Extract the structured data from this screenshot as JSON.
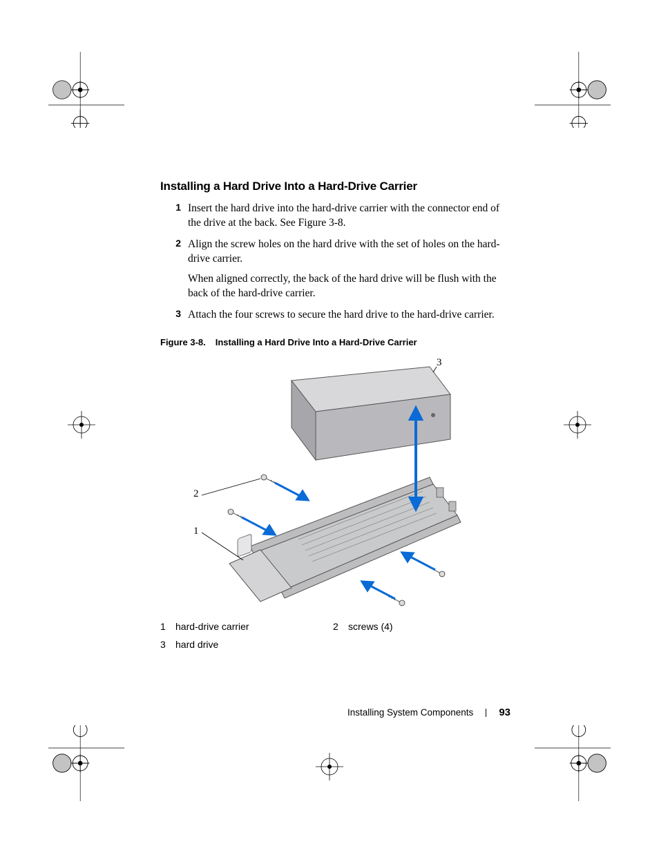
{
  "heading": "Installing a Hard Drive Into a Hard-Drive Carrier",
  "steps": [
    {
      "n": "1",
      "text": "Insert the hard drive into the hard-drive carrier with the connector end of the drive at the back. See Figure 3-8."
    },
    {
      "n": "2",
      "text": "Align the screw holes on the hard drive with the set of holes on the hard-drive carrier.",
      "note": "When aligned correctly, the back of the hard drive will be flush with the back of the hard-drive carrier."
    },
    {
      "n": "3",
      "text": "Attach the four screws to secure the hard drive to the hard-drive carrier."
    }
  ],
  "figure": {
    "label": "Figure 3-8.",
    "title": "Installing a Hard Drive Into a Hard-Drive Carrier",
    "callouts": {
      "c1": "1",
      "c2": "2",
      "c3": "3"
    }
  },
  "legend": [
    {
      "n": "1",
      "label": "hard-drive carrier"
    },
    {
      "n": "2",
      "label": "screws (4)"
    },
    {
      "n": "3",
      "label": "hard drive"
    }
  ],
  "footer": {
    "section": "Installing System Components",
    "page": "93"
  }
}
